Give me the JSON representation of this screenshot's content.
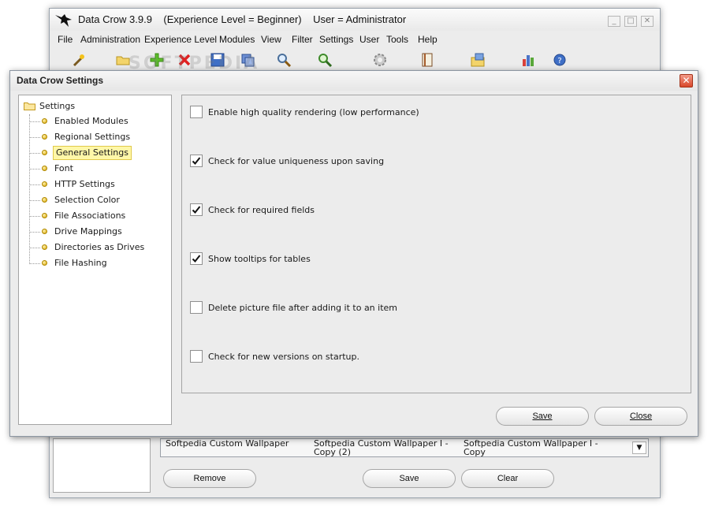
{
  "main_window": {
    "title": "Data Crow 3.9.9    (Experience Level = Beginner)    User = Administrator",
    "menu": [
      "File",
      "Administration",
      "Experience Level",
      "Modules",
      "View",
      "Filter",
      "Settings",
      "User",
      "Tools",
      "Help"
    ],
    "toolbar_icons": [
      "wand-icon",
      "folder-open-icon",
      "add-icon",
      "delete-icon",
      "save-icon",
      "copy-icon",
      "search-icon",
      "find-icon",
      "gear-icon",
      "book-icon",
      "folder-box-icon",
      "chart-icon",
      "help-icon"
    ],
    "watermark": "SOFTPEDIA",
    "table_row": {
      "cells": [
        "Softpedia Custom Wallpaper",
        "Softpedia Custom Wallpaper I - Copy (2)",
        "Softpedia Custom Wallpaper I - Copy"
      ]
    },
    "buttons": {
      "remove": "Remove",
      "save": "Save",
      "clear": "Clear"
    }
  },
  "dialog": {
    "title": "Data Crow Settings",
    "tree": {
      "root": "Settings",
      "items": [
        "Enabled Modules",
        "Regional Settings",
        "General Settings",
        "Font",
        "HTTP Settings",
        "Selection Color",
        "File Associations",
        "Drive Mappings",
        "Directories as Drives",
        "File Hashing"
      ],
      "selected": "General Settings"
    },
    "options": [
      {
        "label": "Enable high quality rendering (low performance)",
        "checked": false
      },
      {
        "label": "Check for value uniqueness upon saving",
        "checked": true
      },
      {
        "label": "Check for required fields",
        "checked": true
      },
      {
        "label": "Show tooltips for tables",
        "checked": true
      },
      {
        "label": "Delete picture file after adding it to an item",
        "checked": false
      },
      {
        "label": "Check for new versions on startup.",
        "checked": false
      }
    ],
    "buttons": {
      "save": "Save",
      "close": "Close"
    }
  },
  "colors": {
    "selected_item_bg": "#fff7a8",
    "close_button": "#d8472a"
  }
}
